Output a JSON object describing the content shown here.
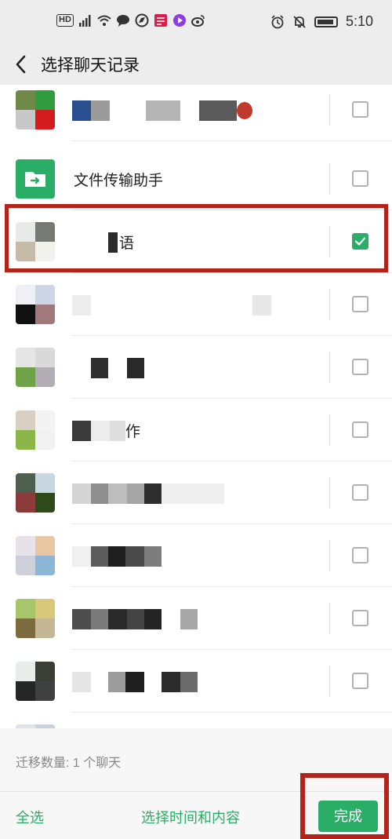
{
  "status_bar": {
    "left_icons": [
      "hd-icon",
      "signal-icon",
      "wifi-icon",
      "message-icon",
      "browser-icon",
      "news-icon",
      "video-icon",
      "weibo-icon"
    ],
    "right_icons": [
      "alarm-icon",
      "mute-icon",
      "battery-icon"
    ],
    "hd": "HD",
    "time": "5:10"
  },
  "title_bar": {
    "title": "选择聊天记录"
  },
  "chats": [
    {
      "name": "",
      "checked": false,
      "avatar_colors": [
        "#6f8a48",
        "#2f9d3d",
        "#c8c8c8",
        "#d41c1c"
      ]
    },
    {
      "name": "文件传输助手",
      "checked": false,
      "avatar": "file-transfer"
    },
    {
      "name": "语",
      "checked": true,
      "avatar_colors": [
        "#e7ebe8",
        "#777a73",
        "#c5bba8",
        "#f2f2ed"
      ]
    },
    {
      "name": "",
      "checked": false,
      "avatar_colors": [
        "#eef0f5",
        "#cdd6e6",
        "#111111",
        "#a07a7a"
      ]
    },
    {
      "name": "",
      "checked": false,
      "avatar_colors": [
        "#e5e5e5",
        "#d9d9d9",
        "#6ea447",
        "#b2acb5"
      ]
    },
    {
      "name": "作",
      "checked": false,
      "avatar_colors": [
        "#d8d0c3",
        "#f3f3f3",
        "#8db64a",
        "#f2f2f2"
      ]
    },
    {
      "name": "",
      "checked": false,
      "avatar_colors": [
        "#4f5f4f",
        "#c7d6e1",
        "#8b3b3b",
        "#2d4a1b"
      ]
    },
    {
      "name": "",
      "checked": false,
      "avatar_colors": [
        "#e8e1ea",
        "#e8c7a2",
        "#cdd0d8",
        "#8bb6d8"
      ]
    },
    {
      "name": "",
      "checked": false,
      "avatar_colors": [
        "#a7c56a",
        "#d9c87a",
        "#7d6a3e",
        "#c4b795"
      ]
    },
    {
      "name": "",
      "checked": false,
      "avatar_colors": [
        "#e8ecea",
        "#3a3f35",
        "#262626",
        "#404040"
      ]
    }
  ],
  "footer": {
    "count_text": "迁移数量:  1 个聊天",
    "select_all": "全选",
    "select_time": "选择时间和内容",
    "done": "完成"
  },
  "colors": {
    "accent": "#2aae67",
    "highlight": "#b4231a",
    "background": "#ededed"
  }
}
